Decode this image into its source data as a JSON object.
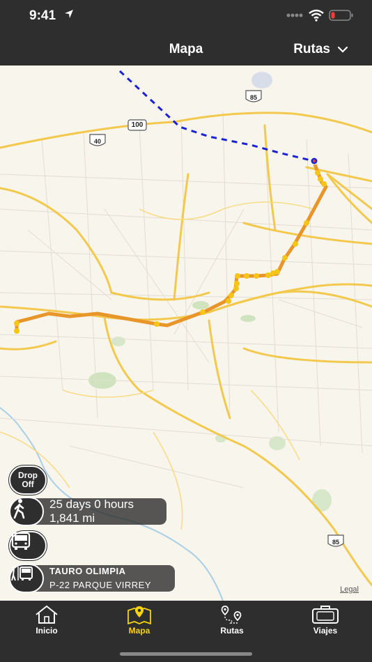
{
  "status_bar": {
    "time": "9:41"
  },
  "navbar": {
    "title": "Mapa",
    "routes_menu_label": "Rutas"
  },
  "map": {
    "legal_label": "Legal",
    "highway_shields": [
      "85",
      "100",
      "40",
      "85"
    ]
  },
  "controls": {
    "dropoff": {
      "line1": "Drop",
      "line2": "Off"
    },
    "walking": {
      "duration": "25 days 0 hours",
      "distance": "1,841 mi"
    },
    "route": {
      "name": "TAURO OLIMPIA",
      "stop": "P-22 PARQUE VIRREY"
    }
  },
  "tabbar": {
    "tabs": [
      {
        "label": "Inicio",
        "icon": "home-icon",
        "active": false
      },
      {
        "label": "Mapa",
        "icon": "map-pin-icon",
        "active": true
      },
      {
        "label": "Rutas",
        "icon": "route-pins-icon",
        "active": false
      },
      {
        "label": "Viajes",
        "icon": "suitcase-icon",
        "active": false
      }
    ]
  },
  "colors": {
    "bar_background": "#2e2e2e",
    "active_tab": "#f5d40f",
    "route_line": "#e8952a",
    "route_stops": "#f5c518",
    "walking_path": "#1a22d6",
    "map_background": "#f8f5ec"
  }
}
